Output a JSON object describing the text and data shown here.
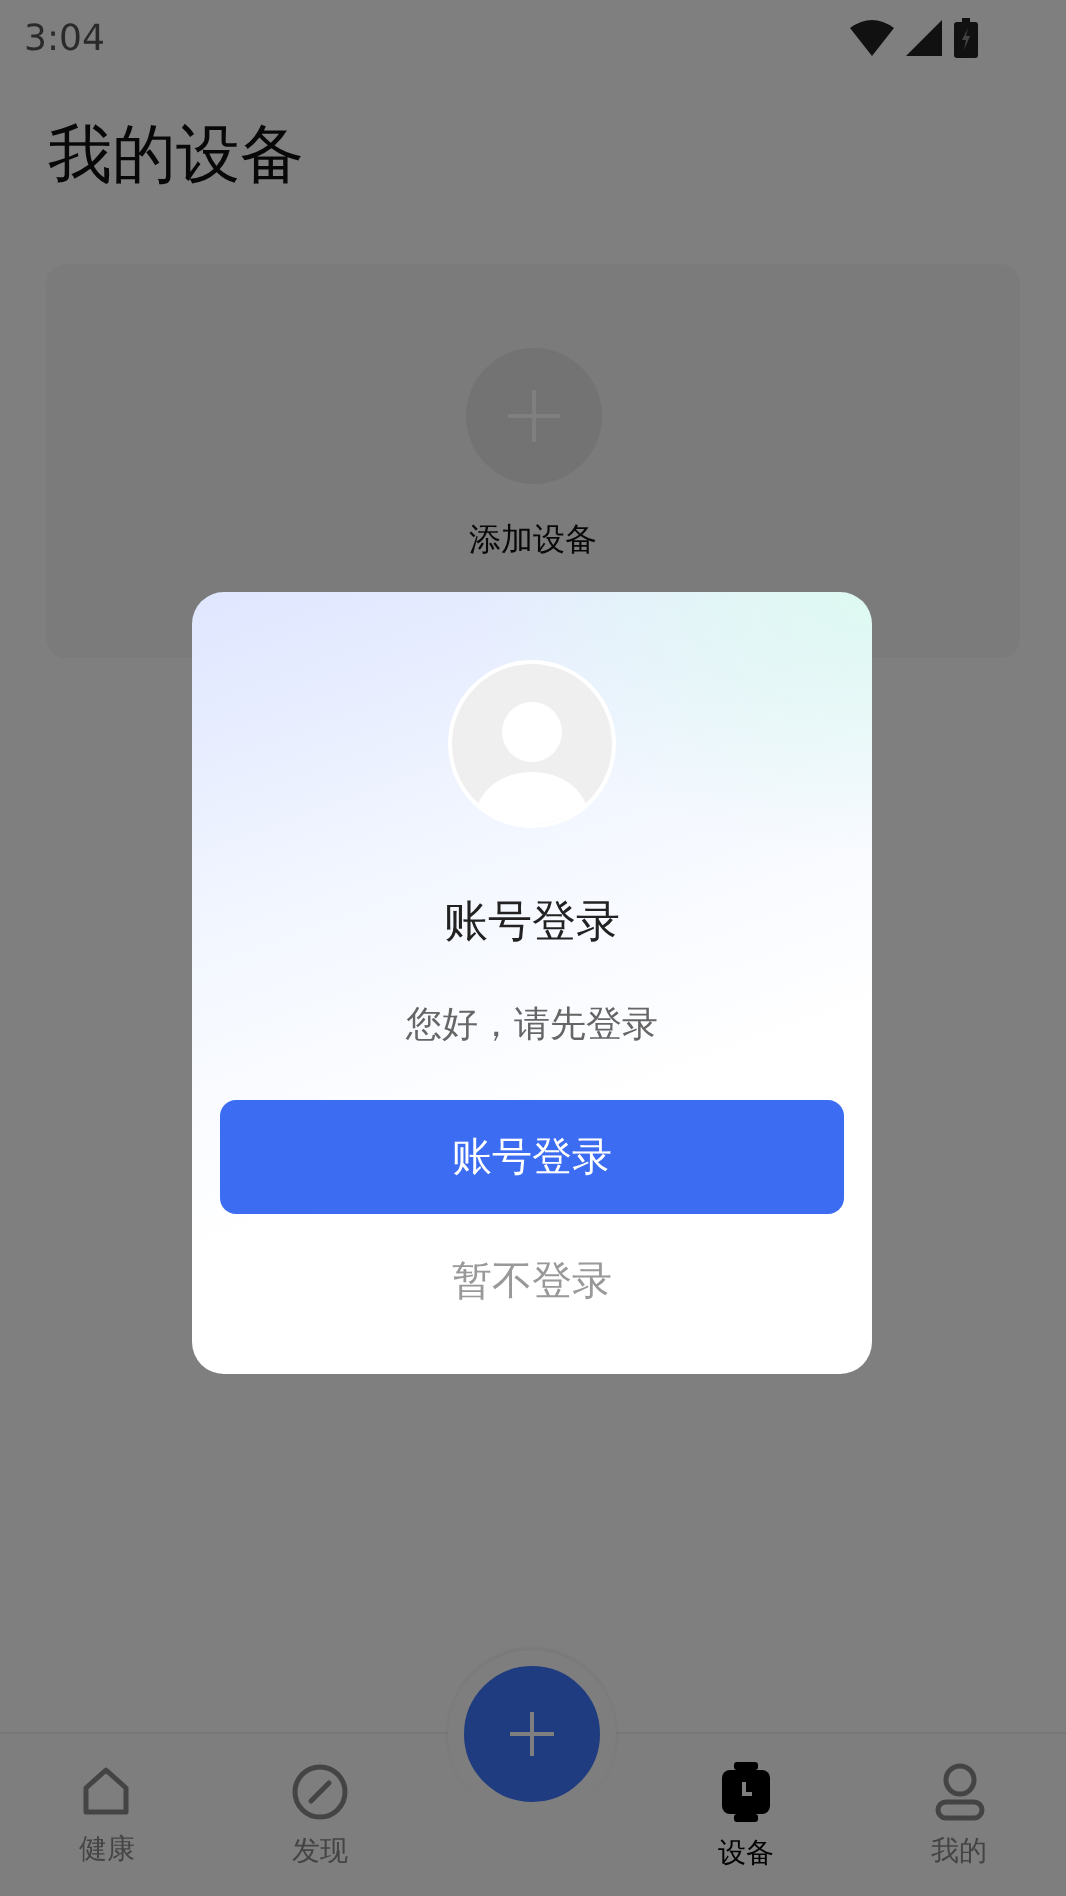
{
  "status_bar": {
    "time": "3:04"
  },
  "title": "我的设备",
  "add_device": {
    "label": "添加设备"
  },
  "dialog": {
    "title": "账号登录",
    "message": "您好，请先登录",
    "buttons": [
      {
        "kind": "primary",
        "label": "账号登录"
      },
      {
        "kind": "secondary",
        "label": "暂不登录"
      }
    ]
  },
  "nav": {
    "tabs": [
      {
        "kind": "home",
        "label": "健康",
        "selected": false
      },
      {
        "kind": "discover",
        "label": "发现",
        "selected": false
      },
      {
        "kind": "device",
        "label": "设备",
        "selected": true
      },
      {
        "kind": "me",
        "label": "我的",
        "selected": false
      }
    ]
  }
}
